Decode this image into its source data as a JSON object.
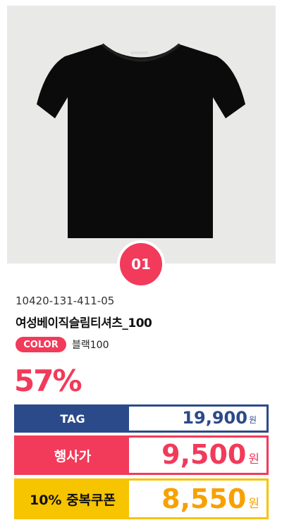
{
  "badge": "01",
  "product": {
    "code": "10420-131-411-05",
    "name": "여성베이직슬림티셔츠_100",
    "color_label": "COLOR",
    "color_value": "블랙100"
  },
  "discount": "57%",
  "prices": {
    "tag_label": "TAG",
    "tag_value": "19,900",
    "tag_unit": "원",
    "sale_label": "행사가",
    "sale_value": "9,500",
    "sale_unit": "원",
    "coupon_label": "10% 중복쿠폰",
    "coupon_value": "8,550",
    "coupon_unit": "원"
  },
  "colors": {
    "accent": "#f23a5a",
    "tag_blue": "#2b4a8a",
    "coupon_yellow": "#f7c400"
  },
  "icons": [
    "black-tshirt-image"
  ]
}
